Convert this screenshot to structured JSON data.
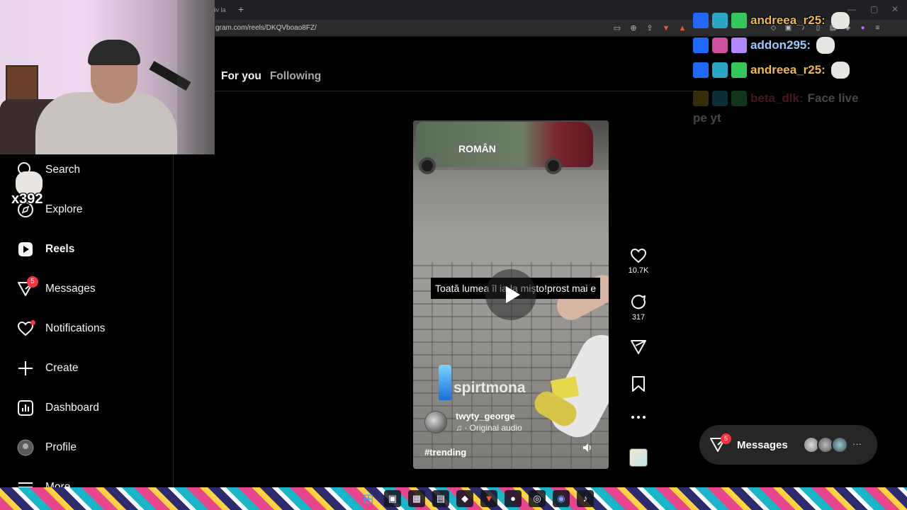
{
  "browser": {
    "tab_fragment": "tiv la",
    "new_tab": "+",
    "url": "gram.com/reels/DKQVboao8FZ/"
  },
  "sidebar": {
    "items": [
      {
        "label": "Search",
        "icon": "search-icon"
      },
      {
        "label": "Explore",
        "icon": "compass-icon"
      },
      {
        "label": "Reels",
        "icon": "reels-icon",
        "active": true
      },
      {
        "label": "Messages",
        "icon": "messenger-icon",
        "badge": "5"
      },
      {
        "label": "Notifications",
        "icon": "heart-icon"
      },
      {
        "label": "Create",
        "icon": "plus-icon"
      },
      {
        "label": "Dashboard",
        "icon": "chart-icon"
      },
      {
        "label": "Profile",
        "icon": "avatar-icon"
      },
      {
        "label": "More",
        "icon": "menu-icon"
      }
    ],
    "emote_count": "x392"
  },
  "feed": {
    "tab_for_you": "For you",
    "tab_following": "Following"
  },
  "reel": {
    "caption_overlay": "Toată lumea îl ia la mișto!prost mai e",
    "van_text": "ROMÂN",
    "watermark": "spirtmona",
    "author": "twyty_george",
    "audio": "· Original audio",
    "hashtag": "#trending",
    "likes": "10.7K",
    "comments": "317"
  },
  "messages_pill": {
    "label": "Messages",
    "badge": "5",
    "more": "···"
  },
  "chat": {
    "lines": [
      {
        "user": "andreea_r25:",
        "color": "#f2b94b"
      },
      {
        "user": "addon295:",
        "color": "#9ec9ff"
      },
      {
        "user": "andreea_r25:",
        "color": "#f2b94b"
      }
    ],
    "faded_user": "beta_dlk:",
    "faded_message_1": "Face live",
    "faded_message_2": "pe yt"
  },
  "colors": {
    "badge_red": "#ff3040",
    "bg": "#000000",
    "pill_bg": "#262626"
  }
}
